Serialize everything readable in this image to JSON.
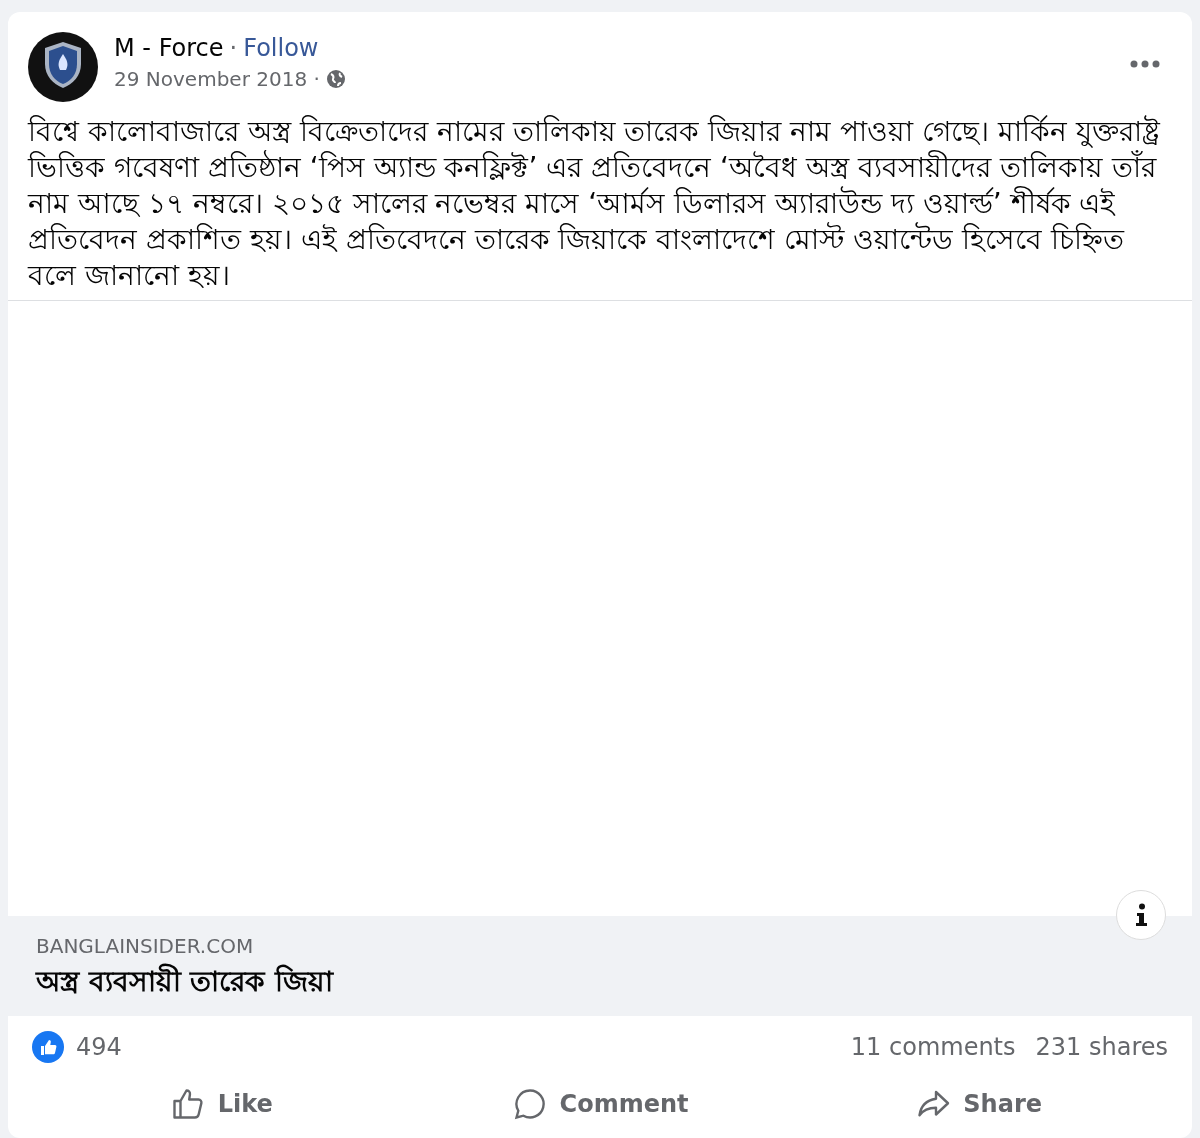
{
  "post": {
    "author": "M - Force",
    "separator": "·",
    "follow": "Follow",
    "date": "29 November 2018 ·",
    "text": "বিশ্বে কালোবাজারে অস্ত্র বিক্রেতাদের নামের তালিকায় তারেক জিয়ার নাম পাওয়া গেছে। মার্কিন যুক্তরাষ্ট্র ভিত্তিক গবেষণা প্রতিষ্ঠান ‘পিস অ্যান্ড কনফ্লিক্ট’ এর প্রতিবেদনে ‘অবৈধ অস্ত্র ব্যবসায়ীদের তালিকায় তাঁর নাম আছে ১৭ নম্বরে। ২০১৫ সালের নভেম্বর মাসে ‘আর্মস ডিলারস অ্যারাউন্ড দ্য ওয়ার্ল্ড’ শীর্ষক এই প্রতিবেদন প্রকাশিত হয়। এই প্রতিবেদনে তারেক জিয়াকে বাংলাদেশে মোস্ট ওয়ান্টেড হিসেবে চিহ্নিত বলে জানানো হয়।"
  },
  "link": {
    "domain": "BANGLAINSIDER.COM",
    "title": "অস্ত্র ব্যবসায়ী তারেক জিয়া"
  },
  "stats": {
    "reactions": "494",
    "comments": "11 comments",
    "shares": "231 shares"
  },
  "actions": [
    {
      "kind": "like",
      "label": "Like"
    },
    {
      "kind": "comment",
      "label": "Comment"
    },
    {
      "kind": "share",
      "label": "Share"
    }
  ]
}
